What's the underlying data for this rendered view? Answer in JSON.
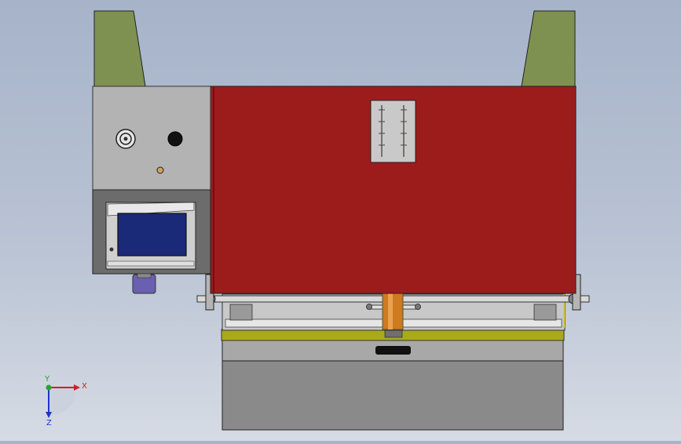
{
  "viewport": {
    "background_top": "#a6b3c9",
    "background_bottom": "#d6dbe4"
  },
  "model": {
    "colors": {
      "frame_red": "#9c1c1c",
      "side_green": "#7f9151",
      "control_box_gray": "#b3b3b3",
      "screen_blue": "#1a2a78",
      "bed_olive": "#a9a91a",
      "base_gray": "#8a8a8a",
      "knob_purple": "#6a5fb0",
      "punch_orange": "#cf7a1e"
    }
  },
  "triad": {
    "x_label": "X",
    "y_label": "Y",
    "z_label": "Z",
    "x_color": "#cc2222",
    "y_color": "#22aa22",
    "z_color": "#2233cc"
  }
}
